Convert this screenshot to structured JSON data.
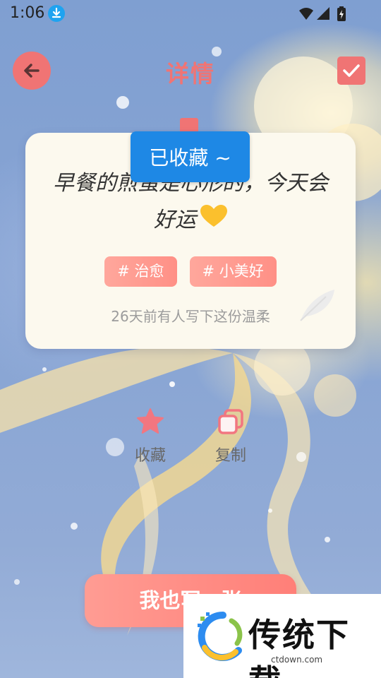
{
  "status_bar": {
    "time": "1:06",
    "icons": [
      "download-icon",
      "wifi-icon",
      "signal-icon",
      "battery-charging-icon"
    ]
  },
  "header": {
    "title": "详情",
    "back_icon": "arrow-left-icon",
    "confirm_icon": "check-icon"
  },
  "card": {
    "quote": "早餐的煎蛋是心形的，今天会好运",
    "quote_icon": "heart-icon",
    "tags": [
      {
        "label": "# 治愈"
      },
      {
        "label": "# 小美好"
      }
    ],
    "written_ago": "26天前有人写下这份温柔",
    "decoration_icon": "feather-icon"
  },
  "toast": {
    "message": "已收藏 ~"
  },
  "actions": {
    "favorite": {
      "label": "收藏",
      "icon": "star-icon"
    },
    "copy": {
      "label": "复制",
      "icon": "copy-icon"
    }
  },
  "write_button": {
    "label": "我也写一张"
  },
  "watermark": {
    "brand": "传统下载",
    "url": "ctdown.com"
  },
  "colors": {
    "accent": "#f07474",
    "toast": "#1e88e5",
    "card_background": "#fcf9ee"
  }
}
